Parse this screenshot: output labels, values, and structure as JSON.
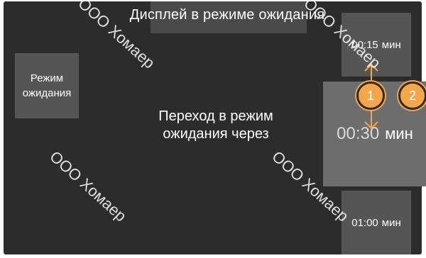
{
  "header": {
    "title": "Дисплей в режиме ожидания"
  },
  "standby_button": {
    "label_line1": "Режим",
    "label_line2": "ожидания"
  },
  "transition": {
    "line1": "Переход в режим",
    "line2": "ожидания через"
  },
  "options": [
    {
      "value": "00:15",
      "unit": "мин",
      "selected": false
    },
    {
      "value": "00:30",
      "unit": "мин",
      "selected": true
    },
    {
      "value": "01:00",
      "unit": "мин",
      "selected": false
    }
  ],
  "markers": {
    "first": "1",
    "second": "2"
  },
  "watermark": "ООО Хомаер",
  "colors": {
    "panel": "#2c2c2c",
    "tile": "#555555",
    "selected_tile": "#6d6d6d",
    "accent": "#f5a54a"
  }
}
